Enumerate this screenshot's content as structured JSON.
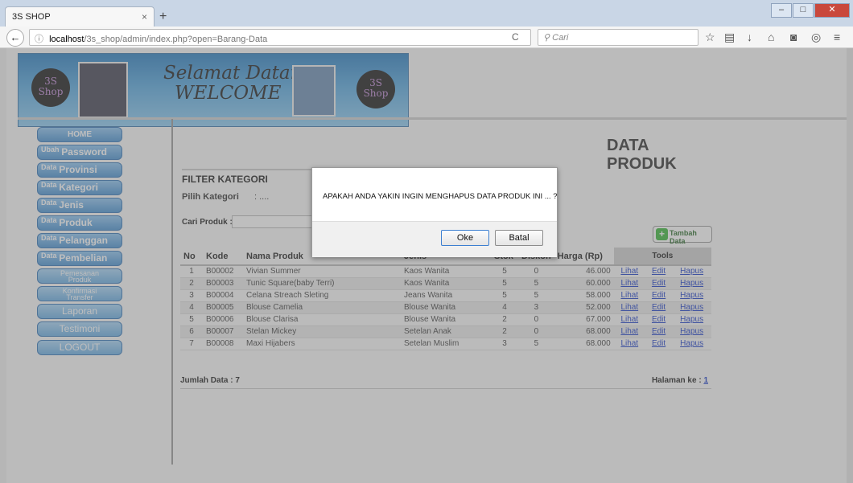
{
  "browser": {
    "tab_title": "3S SHOP",
    "tab_close": "×",
    "new_tab": "+",
    "url_host": "localhost",
    "url_path": "/3s_shop/admin/index.php?open=Barang-Data",
    "search_placeholder": "Cari",
    "win_buttons": [
      "–",
      "□",
      "✕"
    ]
  },
  "banner": {
    "logo_text_1": "3S",
    "logo_text_2": "Shop",
    "welcome_line1": "Selamat Datang",
    "welcome_line2": "WELCOME"
  },
  "sidebar": {
    "home": "HOME",
    "items2": [
      {
        "sup": "Ubah",
        "big": "Password"
      },
      {
        "sup": "Data",
        "big": "Provinsi"
      },
      {
        "sup": "Data",
        "big": "Kategori"
      },
      {
        "sup": "Data",
        "big": "Jenis"
      },
      {
        "sup": "Data",
        "big": "Produk"
      },
      {
        "sup": "Data",
        "big": "Pelanggan"
      },
      {
        "sup": "Data",
        "big": "Pembelian"
      }
    ],
    "pemesanan_1": "Pemesanan",
    "pemesanan_2": "Produk",
    "konfirmasi_1": "Konfirmasi",
    "konfirmasi_2": "Transfer",
    "laporan": "Laporan",
    "testimoni": "Testimoni",
    "logout": "LOGOUT"
  },
  "main": {
    "title": "DATA PRODUK",
    "filter_title": "FILTER KATEGORI",
    "filter_label": "Pilih Kategori",
    "filter_value": ": ....",
    "search_label": "Cari Produk :",
    "add_button": "Tambah Data",
    "add_icon": "+",
    "columns": [
      "No",
      "Kode",
      "Nama Produk",
      "Jenis",
      "Stok",
      "Diskon",
      "Harga (Rp)",
      "Tools"
    ],
    "rows": [
      {
        "no": "1",
        "kode": "B00002",
        "nama": "Vivian Summer",
        "jenis": "Kaos Wanita",
        "stok": "5",
        "diskon": "0",
        "harga": "46.000"
      },
      {
        "no": "2",
        "kode": "B00003",
        "nama": "Tunic Square(baby Terri)",
        "jenis": "Kaos Wanita",
        "stok": "5",
        "diskon": "5",
        "harga": "60.000"
      },
      {
        "no": "3",
        "kode": "B00004",
        "nama": "Celana Streach Sleting",
        "jenis": "Jeans Wanita",
        "stok": "5",
        "diskon": "5",
        "harga": "58.000"
      },
      {
        "no": "4",
        "kode": "B00005",
        "nama": "Blouse Camelia",
        "jenis": "Blouse Wanita",
        "stok": "4",
        "diskon": "3",
        "harga": "52.000"
      },
      {
        "no": "5",
        "kode": "B00006",
        "nama": "Blouse Clarisa",
        "jenis": "Blouse Wanita",
        "stok": "2",
        "diskon": "0",
        "harga": "67.000"
      },
      {
        "no": "6",
        "kode": "B00007",
        "nama": "Stelan Mickey",
        "jenis": "Setelan Anak",
        "stok": "2",
        "diskon": "0",
        "harga": "68.000"
      },
      {
        "no": "7",
        "kode": "B00008",
        "nama": "Maxi Hijabers",
        "jenis": "Setelan Muslim",
        "stok": "3",
        "diskon": "5",
        "harga": "68.000"
      }
    ],
    "link_lihat": "Lihat",
    "link_edit": "Edit",
    "link_hapus": "Hapus",
    "jumlah_data": "Jumlah Data : 7",
    "halaman_label": "Halaman ke : ",
    "halaman_num": "1"
  },
  "dialog": {
    "message": "APAKAH ANDA YAKIN INGIN MENGHAPUS DATA PRODUK INI ... ?",
    "ok_label": "Oke",
    "cancel_label": "Batal"
  },
  "icons": {
    "back": "←",
    "info": "ⓘ",
    "reload": "C",
    "search": "🔍",
    "star": "☆",
    "menu": "≡"
  }
}
